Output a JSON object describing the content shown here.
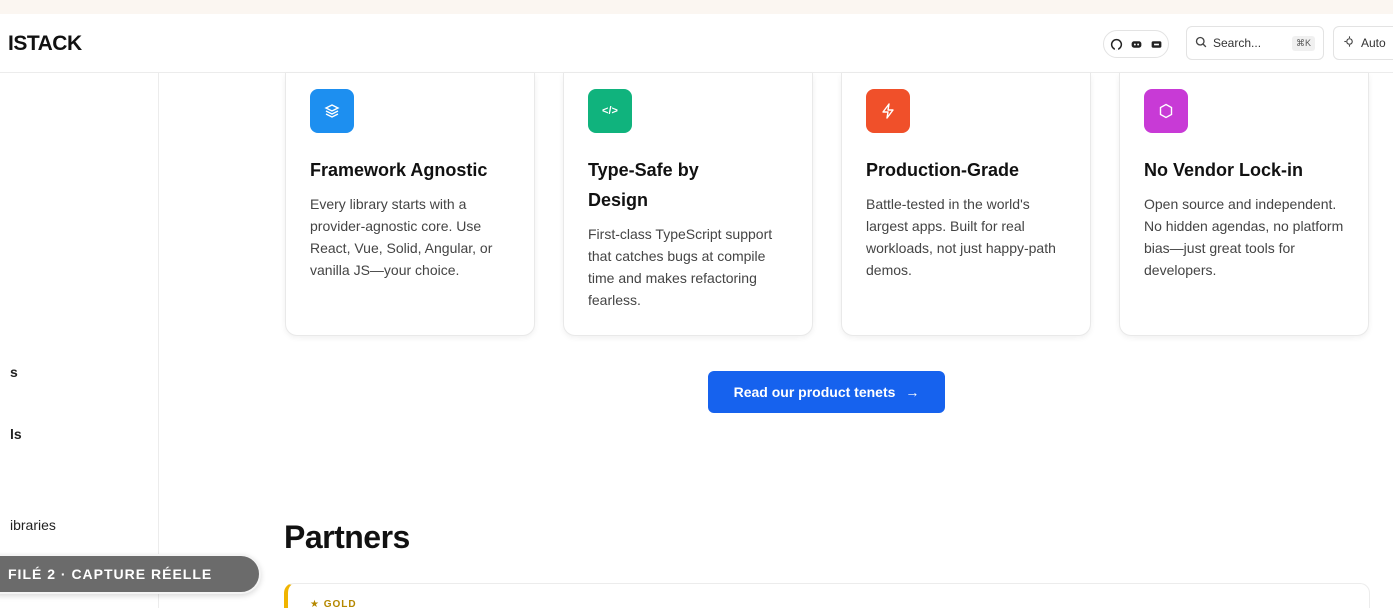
{
  "header": {
    "logo_text": "ISTACK",
    "social_icons": [
      "github-icon",
      "discord-icon",
      "x-icon"
    ],
    "search": {
      "label": "Search...",
      "shortcut": "⌘K",
      "icon": "search-icon"
    },
    "theme": {
      "label": "Auto",
      "icon": "theme-icon"
    }
  },
  "sidebar": {
    "items": [
      {
        "label": "s"
      },
      {
        "label": "ls"
      },
      {
        "label": "ibraries"
      }
    ]
  },
  "features": [
    {
      "icon": "layers-icon",
      "color": "#1d8ff0",
      "title": "Framework Agnostic",
      "description": "Every library starts with a provider-agnostic core. Use React, Vue, Solid, Angular, or vanilla JS—your choice."
    },
    {
      "icon": "code-icon",
      "color": "#10b37d",
      "title": "Type-Safe by Design",
      "description": "First-class TypeScript support that catches bugs at compile time and makes refactoring fearless."
    },
    {
      "icon": "bolt-icon",
      "color": "#f0502a",
      "title": "Production-Grade",
      "description": "Battle-tested in the world's largest apps. Built for real workloads, not just happy-path demos."
    },
    {
      "icon": "shield-icon",
      "color": "#c83ad6",
      "title": "No Vendor Lock-in",
      "description": "Open source and independent. No hidden agendas, no platform bias—just great tools for developers."
    }
  ],
  "cta": {
    "label": "Read our product tenets",
    "arrow": "→"
  },
  "partners": {
    "title": "Partners",
    "tier_label": "★ GOLD",
    "tier_color": "#f0b400"
  },
  "overlay": {
    "label": "FILÉ 2 · CAPTURE RÉELLE"
  }
}
